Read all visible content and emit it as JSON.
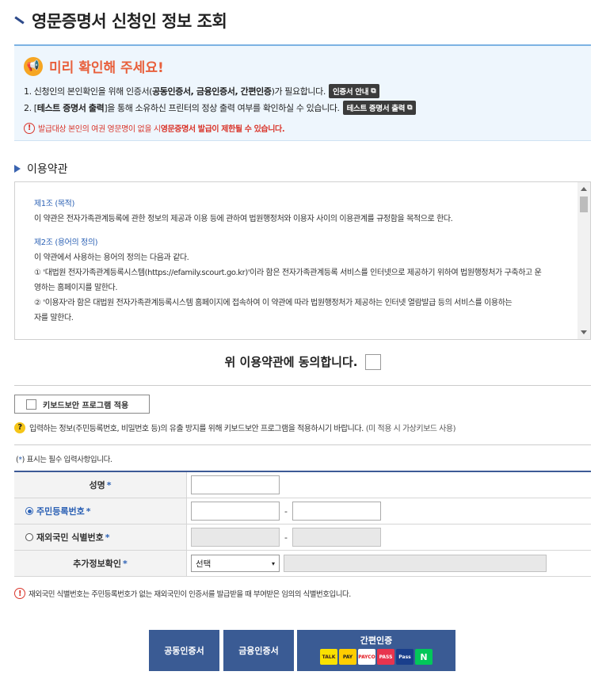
{
  "page": {
    "title": "영문증명서 신청인 정보 조회"
  },
  "notice": {
    "heading": "미리 확인해 주세요!",
    "line1_pre": "1. 신청인의 본인확인을 위해 인증서(",
    "line1_bold": "공동인증서, 금융인증서, 간편인증",
    "line1_post": ")가 필요합니다.",
    "line1_button": "인증서 안내",
    "line2_pre": "2. [",
    "line2_bold": "테스트 증명서 출력",
    "line2_post": "]을 통해 소유하신 프린터의 정상 출력 여부를 확인하실 수 있습니다.",
    "line2_button": "테스트 증명서 출력",
    "warning_pre": "발급대상 본인의 여권 영문명이 없을 시 ",
    "warning_bold": "영문증명서 발급이 제한될 수 있습니다."
  },
  "terms": {
    "section_title": "이용약관",
    "art1_title": "제1조 (목적)",
    "art1_body": "이 약관은 전자가족관계등록에 관한 정보의 제공과 이용 등에 관하여 법원행정처와 이용자 사이의 이용관계를 규정함을 목적으로 한다.",
    "art2_title": "제2조 (용어의 정의)",
    "art2_intro": "이 약관에서 사용하는 용어의 정의는 다음과 같다.",
    "art2_item1a": "① '대법원 전자가족관계등록시스템(https://efamily.scourt.go.kr)'이라 함은 전자가족관계등록 서비스를 인터넷으로 제공하기 위하여 법원행정처가 구축하고 운",
    "art2_item1b": "영하는 홈페이지를 말한다.",
    "art2_item2a": "② '이용자'라 함은 대법원 전자가족관계등록시스템 홈페이지에 접속하여 이 약관에 따라 법원행정처가 제공하는 인터넷 열람발급 등의 서비스를 이용하는",
    "art2_item2b": "자를 말한다."
  },
  "agree": {
    "label": "위 이용약관에 동의합니다."
  },
  "keyboard": {
    "button_label": "키보드보안 프로그램 적용",
    "help_text": "입력하는 정보(주민등록번호, 비밀번호 등)의 유출 방지를 위해 키보드보안 프로그램을 적용하시기 바랍니다.",
    "help_dim": "(미 적용 시 가상키보드 사용)"
  },
  "form": {
    "required_note_pre": "(",
    "required_note_star": "*",
    "required_note_post": ") 표시는 필수 입력사항입니다.",
    "name_label": "성명",
    "rrn_label": "주민등록번호",
    "foreign_label": "재외국민 식별번호",
    "extra_label": "추가정보확인",
    "star": "*",
    "dash": "-",
    "select_value": "선택",
    "select_arrow": "▾"
  },
  "footer_note": "재외국민 식별번호는 주민등록번호가 없는 재외국민이 인증서를 발급받을 때 부여받은 임의의 식별번호입니다.",
  "buttons": {
    "joint_cert": "공동인증서",
    "financial_cert": "금융인증서",
    "easy_cert": "간편인증",
    "logos": [
      "TALK",
      "PAY",
      "PAYCO",
      "PASS",
      "Pass",
      "N"
    ]
  },
  "icons": {
    "megaphone": "📢",
    "excl": "!",
    "question": "?",
    "external": "⧉"
  },
  "colors": {
    "accent_blue": "#3a5b94",
    "warning_red": "#d9352b",
    "notice_bg": "#eef6fd"
  }
}
